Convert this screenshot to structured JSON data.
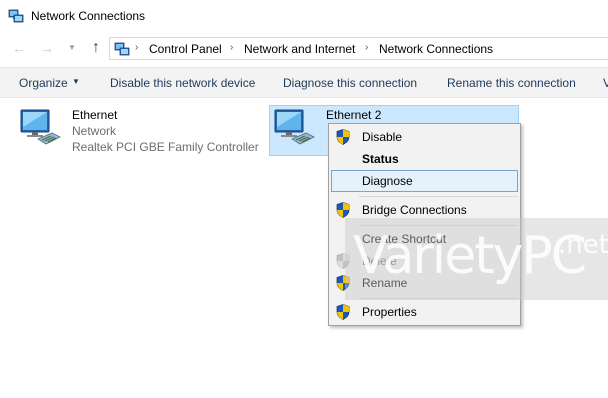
{
  "window": {
    "title": "Network Connections"
  },
  "address": {
    "crumbs": [
      "Control Panel",
      "Network and Internet",
      "Network Connections"
    ]
  },
  "commands": {
    "organize": "Organize",
    "disable": "Disable this network device",
    "diagnose": "Diagnose this connection",
    "rename": "Rename this connection",
    "overflow": "V"
  },
  "connections": [
    {
      "name": "Ethernet",
      "status": "Network",
      "adapter": "Realtek PCI GBE Family Controller"
    },
    {
      "name": "Ethernet 2"
    }
  ],
  "context_menu": {
    "items": [
      {
        "label": "Disable",
        "icon": "uac-shield-icon"
      },
      {
        "label": "Status",
        "bold": true
      },
      {
        "label": "Diagnose",
        "highlighted": true
      },
      {
        "label": "Bridge Connections",
        "icon": "uac-shield-icon"
      },
      {
        "label": "Create Shortcut"
      },
      {
        "label": "Delete",
        "icon": "uac-shield-icon",
        "disabled": true
      },
      {
        "label": "Rename",
        "icon": "uac-shield-icon"
      },
      {
        "label": "Properties",
        "icon": "uac-shield-icon"
      }
    ]
  },
  "watermark": {
    "brand": "VarietyPC",
    "suffix": ".net"
  },
  "colors": {
    "selection_bg": "#cce8ff",
    "selection_border": "#99d1ff",
    "menu_bg": "#f2f2f2",
    "command_text": "#1e395b"
  }
}
